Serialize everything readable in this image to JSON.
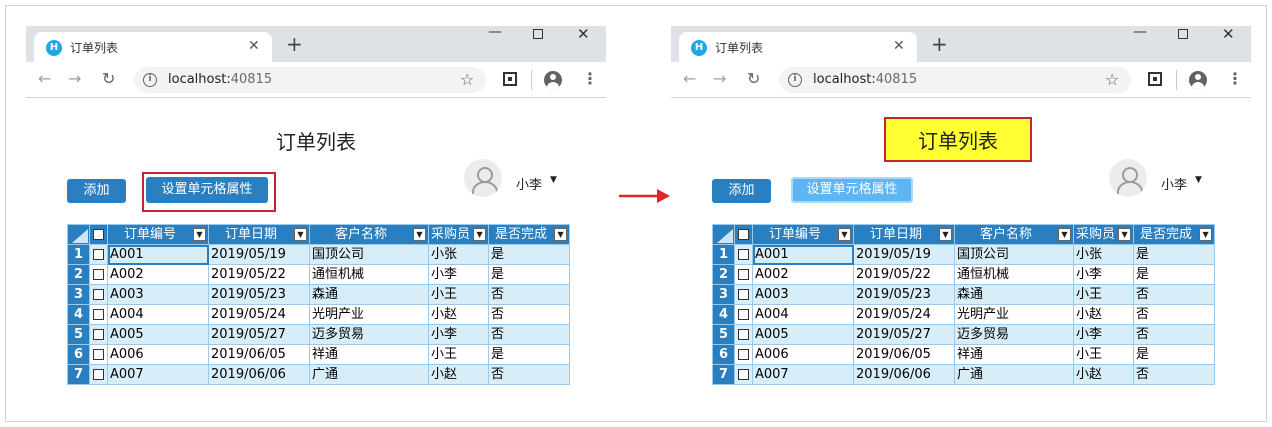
{
  "browser": {
    "tab_title": "订单列表",
    "tab_favicon": "H",
    "url_host": "localhost:",
    "url_port": "40815"
  },
  "page": {
    "title": "订单列表",
    "add_button": "添加",
    "set_cell_button": "设置单元格属性",
    "user_name": "小李"
  },
  "grid": {
    "columns": [
      "订单编号",
      "订单日期",
      "客户名称",
      "采购员",
      "是否完成"
    ],
    "rows": [
      {
        "num": "1",
        "id": "A001",
        "date": "2019/05/19",
        "customer": "国顶公司",
        "buyer": "小张",
        "done": "是"
      },
      {
        "num": "2",
        "id": "A002",
        "date": "2019/05/22",
        "customer": "通恒机械",
        "buyer": "小李",
        "done": "是"
      },
      {
        "num": "3",
        "id": "A003",
        "date": "2019/05/23",
        "customer": "森通",
        "buyer": "小王",
        "done": "否"
      },
      {
        "num": "4",
        "id": "A004",
        "date": "2019/05/24",
        "customer": "光明产业",
        "buyer": "小赵",
        "done": "否"
      },
      {
        "num": "5",
        "id": "A005",
        "date": "2019/05/27",
        "customer": "迈多贸易",
        "buyer": "小李",
        "done": "否"
      },
      {
        "num": "6",
        "id": "A006",
        "date": "2019/06/05",
        "customer": "祥通",
        "buyer": "小王",
        "done": "是"
      },
      {
        "num": "7",
        "id": "A007",
        "date": "2019/06/06",
        "customer": "广通",
        "buyer": "小赵",
        "done": "否"
      }
    ]
  },
  "colors": {
    "header_blue": "#2a7fc1",
    "row_alt": "#d7eef9",
    "highlight_yellow": "#ffff33",
    "annotation_red": "#c0272d"
  }
}
